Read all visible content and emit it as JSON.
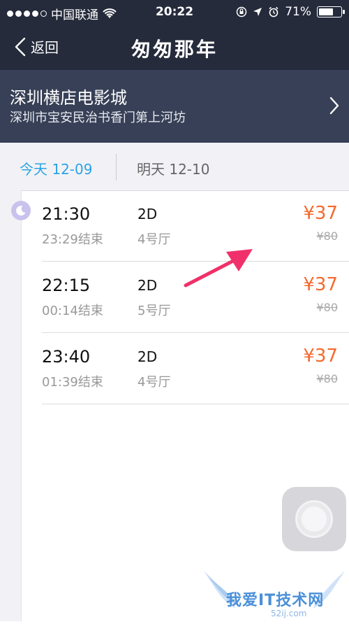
{
  "status_bar": {
    "carrier": "中国联通",
    "time": "20:22",
    "battery": "71%",
    "battery_level": 0.71,
    "signal_bars_filled": 4,
    "signal_bars_total": 5
  },
  "nav": {
    "back_label": "返回",
    "title": "匆匆那年"
  },
  "cinema": {
    "name": "深圳横店电影城",
    "address": "深圳市宝安民治书香门第上河坊"
  },
  "tabs": [
    {
      "label": "今天 12-09",
      "selected": true
    },
    {
      "label": "明天 12-10",
      "selected": false
    }
  ],
  "showtimes": [
    {
      "start": "21:30",
      "end": "23:29结束",
      "format": "2D",
      "hall": "4号厅",
      "price": "¥37",
      "original_price": "¥80"
    },
    {
      "start": "22:15",
      "end": "00:14结束",
      "format": "2D",
      "hall": "5号厅",
      "price": "¥37",
      "original_price": "¥80"
    },
    {
      "start": "23:40",
      "end": "01:39结束",
      "format": "2D",
      "hall": "4号厅",
      "price": "¥37",
      "original_price": "¥80"
    }
  ],
  "watermark": {
    "text": "我爱IT技术网",
    "sub": "52ij.com"
  },
  "colors": {
    "header_bg": "#252b3b",
    "cinema_bg": "#374056",
    "accent_blue": "#2ba3e6",
    "price_orange": "#f4692d",
    "arrow_pink": "#f0306a"
  },
  "icons": {
    "back": "chevron-left-icon",
    "cinema_detail": "chevron-right-icon",
    "night": "moon-icon",
    "wifi": "wifi-icon",
    "lock": "rotation-lock-icon",
    "location": "location-arrow-icon",
    "alarm": "alarm-icon"
  }
}
